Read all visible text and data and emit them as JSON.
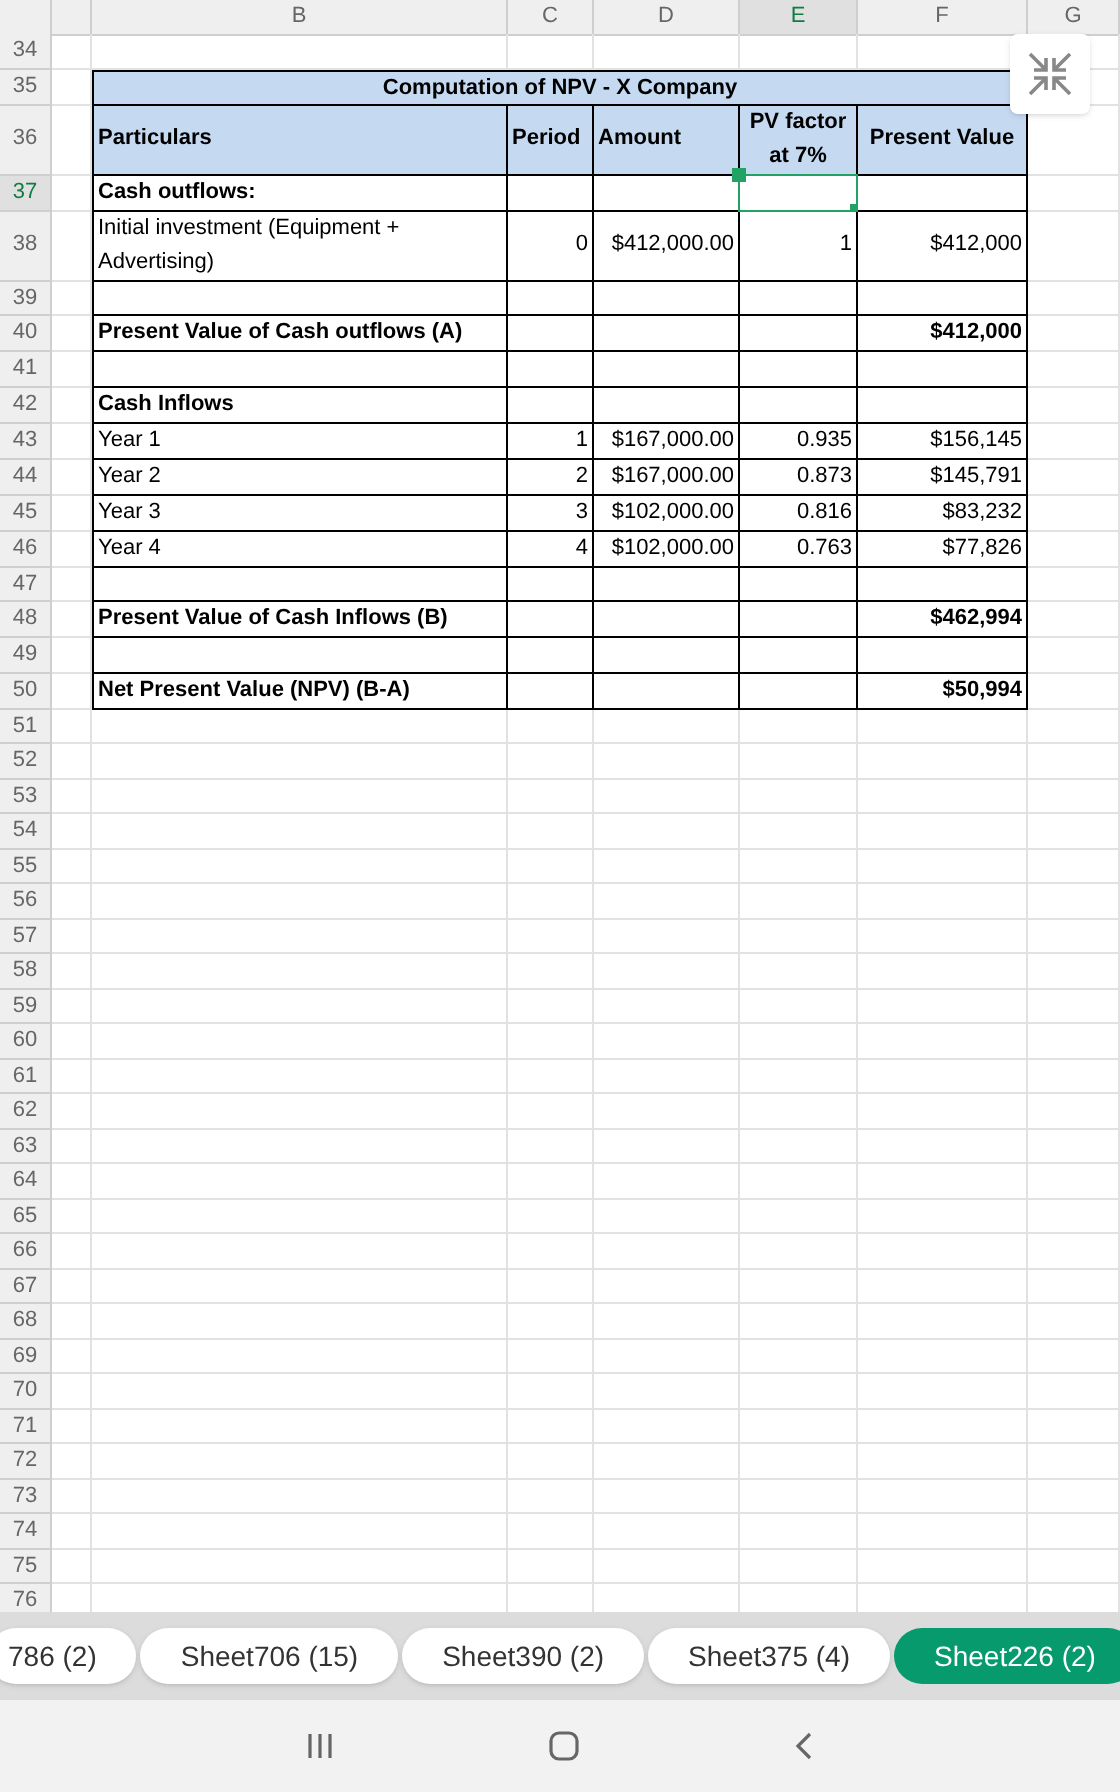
{
  "columns": [
    {
      "label": "B",
      "selected": false
    },
    {
      "label": "C",
      "selected": false
    },
    {
      "label": "D",
      "selected": false
    },
    {
      "label": "E",
      "selected": true
    },
    {
      "label": "F",
      "selected": false
    },
    {
      "label": "G",
      "selected": false
    }
  ],
  "rows": [
    {
      "number": "34",
      "selected": false,
      "kind": "blank"
    },
    {
      "number": "35",
      "selected": false,
      "kind": "title",
      "title": "Computation of NPV - X Company"
    },
    {
      "number": "36",
      "selected": false,
      "kind": "header",
      "particulars": "Particulars",
      "period": "Period",
      "amount": "Amount",
      "pv_factor": "PV factor at 7%",
      "present_value": "Present Value"
    },
    {
      "number": "37",
      "selected": true,
      "kind": "data",
      "bold": true,
      "particulars": "Cash outflows:"
    },
    {
      "number": "38",
      "selected": false,
      "kind": "data",
      "bold": false,
      "particulars": "Initial investment (Equipment + Advertising)",
      "period": "0",
      "amount": "$412,000.00",
      "pv_factor": "1",
      "present_value": "$412,000"
    },
    {
      "number": "39",
      "selected": false,
      "kind": "data"
    },
    {
      "number": "40",
      "selected": false,
      "kind": "data",
      "bold": true,
      "particulars": "Present Value of Cash outflows (A)",
      "present_value": "$412,000"
    },
    {
      "number": "41",
      "selected": false,
      "kind": "data"
    },
    {
      "number": "42",
      "selected": false,
      "kind": "data",
      "bold": true,
      "particulars": "Cash Inflows"
    },
    {
      "number": "43",
      "selected": false,
      "kind": "data",
      "bold": false,
      "particulars": "Year 1",
      "period": "1",
      "amount": "$167,000.00",
      "pv_factor": "0.935",
      "present_value": "$156,145"
    },
    {
      "number": "44",
      "selected": false,
      "kind": "data",
      "bold": false,
      "particulars": "Year 2",
      "period": "2",
      "amount": "$167,000.00",
      "pv_factor": "0.873",
      "present_value": "$145,791"
    },
    {
      "number": "45",
      "selected": false,
      "kind": "data",
      "bold": false,
      "particulars": "Year 3",
      "period": "3",
      "amount": "$102,000.00",
      "pv_factor": "0.816",
      "present_value": "$83,232"
    },
    {
      "number": "46",
      "selected": false,
      "kind": "data",
      "bold": false,
      "particulars": "Year 4",
      "period": "4",
      "amount": "$102,000.00",
      "pv_factor": "0.763",
      "present_value": "$77,826"
    },
    {
      "number": "47",
      "selected": false,
      "kind": "data"
    },
    {
      "number": "48",
      "selected": false,
      "kind": "data",
      "bold": true,
      "particulars": "Present Value of Cash Inflows (B)",
      "present_value": "$462,994"
    },
    {
      "number": "49",
      "selected": false,
      "kind": "data"
    },
    {
      "number": "50",
      "selected": false,
      "kind": "data",
      "bold": true,
      "particulars": "Net Present Value (NPV) (B-A)",
      "present_value": "$50,994"
    },
    {
      "number": "51",
      "selected": false,
      "kind": "blank"
    },
    {
      "number": "52",
      "selected": false,
      "kind": "blank"
    },
    {
      "number": "53",
      "selected": false,
      "kind": "blank"
    },
    {
      "number": "54",
      "selected": false,
      "kind": "blank"
    },
    {
      "number": "55",
      "selected": false,
      "kind": "blank"
    },
    {
      "number": "56",
      "selected": false,
      "kind": "blank"
    },
    {
      "number": "57",
      "selected": false,
      "kind": "blank"
    },
    {
      "number": "58",
      "selected": false,
      "kind": "blank"
    },
    {
      "number": "59",
      "selected": false,
      "kind": "blank"
    },
    {
      "number": "60",
      "selected": false,
      "kind": "blank"
    },
    {
      "number": "61",
      "selected": false,
      "kind": "blank"
    },
    {
      "number": "62",
      "selected": false,
      "kind": "blank"
    },
    {
      "number": "63",
      "selected": false,
      "kind": "blank"
    },
    {
      "number": "64",
      "selected": false,
      "kind": "blank"
    },
    {
      "number": "65",
      "selected": false,
      "kind": "blank"
    },
    {
      "number": "66",
      "selected": false,
      "kind": "blank"
    },
    {
      "number": "67",
      "selected": false,
      "kind": "blank"
    },
    {
      "number": "68",
      "selected": false,
      "kind": "blank"
    },
    {
      "number": "69",
      "selected": false,
      "kind": "blank"
    },
    {
      "number": "70",
      "selected": false,
      "kind": "blank"
    },
    {
      "number": "71",
      "selected": false,
      "kind": "blank"
    },
    {
      "number": "72",
      "selected": false,
      "kind": "blank"
    },
    {
      "number": "73",
      "selected": false,
      "kind": "blank"
    },
    {
      "number": "74",
      "selected": false,
      "kind": "blank"
    },
    {
      "number": "75",
      "selected": false,
      "kind": "blank"
    },
    {
      "number": "76",
      "selected": false,
      "kind": "blank"
    }
  ],
  "sheet_tabs": [
    {
      "label": "786 (2)",
      "selected": false
    },
    {
      "label": "Sheet706 (15)",
      "selected": false
    },
    {
      "label": "Sheet390 (2)",
      "selected": false
    },
    {
      "label": "Sheet375 (4)",
      "selected": false
    },
    {
      "label": "Sheet226 (2)",
      "selected": true
    }
  ]
}
